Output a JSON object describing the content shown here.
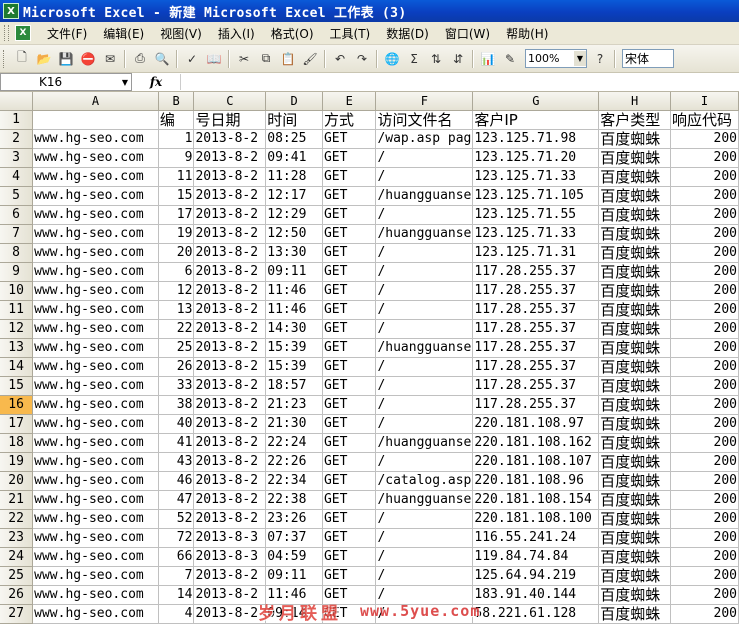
{
  "window": {
    "title": "Microsoft Excel - 新建 Microsoft Excel 工作表 (3)",
    "icon_text": "X"
  },
  "menu": {
    "items": [
      "文件(F)",
      "编辑(E)",
      "视图(V)",
      "插入(I)",
      "格式(O)",
      "工具(T)",
      "数据(D)",
      "窗口(W)",
      "帮助(H)"
    ]
  },
  "toolbar": {
    "zoom": "100%",
    "font": "宋体",
    "icons": [
      "new-icon",
      "open-icon",
      "save-icon",
      "permission-icon",
      "email-icon",
      "print-icon",
      "print-preview-icon",
      "spelling-icon",
      "research-icon",
      "cut-icon",
      "copy-icon",
      "paste-icon",
      "format-painter-icon",
      "undo-icon",
      "redo-icon",
      "hyperlink-icon",
      "autosum-icon",
      "sort-ascending-icon",
      "sort-descending-icon",
      "chart-wizard-icon",
      "drawing-icon",
      "help-icon"
    ]
  },
  "formula_bar": {
    "name_box": "K16",
    "fx": "fx",
    "formula": ""
  },
  "sheet": {
    "columns": [
      "A",
      "B",
      "C",
      "D",
      "E",
      "F",
      "G",
      "H",
      "I"
    ],
    "active_row": 16,
    "header_row": [
      "",
      "编",
      "号日期",
      "时间",
      "方式",
      "访问文件名",
      "客户IP",
      "客户类型",
      "响应代码"
    ],
    "rows": [
      [
        "www.hg-seo.com",
        "1",
        "2013-8-2",
        "08:25",
        "GET",
        "/wap.asp pag",
        "123.125.71.98",
        "百度蜘蛛",
        "200"
      ],
      [
        "www.hg-seo.com",
        "9",
        "2013-8-2",
        "09:41",
        "GET",
        "/",
        "123.125.71.20",
        "百度蜘蛛",
        "200"
      ],
      [
        "www.hg-seo.com",
        "11",
        "2013-8-2",
        "11:28",
        "GET",
        "/",
        "123.125.71.33",
        "百度蜘蛛",
        "200"
      ],
      [
        "www.hg-seo.com",
        "15",
        "2013-8-2",
        "12:17",
        "GET",
        "/huangguanse",
        "123.125.71.105",
        "百度蜘蛛",
        "200"
      ],
      [
        "www.hg-seo.com",
        "17",
        "2013-8-2",
        "12:29",
        "GET",
        "/",
        "123.125.71.55",
        "百度蜘蛛",
        "200"
      ],
      [
        "www.hg-seo.com",
        "19",
        "2013-8-2",
        "12:50",
        "GET",
        "/huangguanse",
        "123.125.71.33",
        "百度蜘蛛",
        "200"
      ],
      [
        "www.hg-seo.com",
        "20",
        "2013-8-2",
        "13:30",
        "GET",
        "/",
        "123.125.71.31",
        "百度蜘蛛",
        "200"
      ],
      [
        "www.hg-seo.com",
        "6",
        "2013-8-2",
        "09:11",
        "GET",
        "/",
        "117.28.255.37",
        "百度蜘蛛",
        "200"
      ],
      [
        "www.hg-seo.com",
        "12",
        "2013-8-2",
        "11:46",
        "GET",
        "/",
        "117.28.255.37",
        "百度蜘蛛",
        "200"
      ],
      [
        "www.hg-seo.com",
        "13",
        "2013-8-2",
        "11:46",
        "GET",
        "/",
        "117.28.255.37",
        "百度蜘蛛",
        "200"
      ],
      [
        "www.hg-seo.com",
        "22",
        "2013-8-2",
        "14:30",
        "GET",
        "/",
        "117.28.255.37",
        "百度蜘蛛",
        "200"
      ],
      [
        "www.hg-seo.com",
        "25",
        "2013-8-2",
        "15:39",
        "GET",
        "/huangguanse",
        "117.28.255.37",
        "百度蜘蛛",
        "200"
      ],
      [
        "www.hg-seo.com",
        "26",
        "2013-8-2",
        "15:39",
        "GET",
        "/",
        "117.28.255.37",
        "百度蜘蛛",
        "200"
      ],
      [
        "www.hg-seo.com",
        "33",
        "2013-8-2",
        "18:57",
        "GET",
        "/",
        "117.28.255.37",
        "百度蜘蛛",
        "200"
      ],
      [
        "www.hg-seo.com",
        "38",
        "2013-8-2",
        "21:23",
        "GET",
        "/",
        "117.28.255.37",
        "百度蜘蛛",
        "200"
      ],
      [
        "www.hg-seo.com",
        "40",
        "2013-8-2",
        "21:30",
        "GET",
        "/",
        "220.181.108.97",
        "百度蜘蛛",
        "200"
      ],
      [
        "www.hg-seo.com",
        "41",
        "2013-8-2",
        "22:24",
        "GET",
        "/huangguanse",
        "220.181.108.162",
        "百度蜘蛛",
        "200"
      ],
      [
        "www.hg-seo.com",
        "43",
        "2013-8-2",
        "22:26",
        "GET",
        "/",
        "220.181.108.107",
        "百度蜘蛛",
        "200"
      ],
      [
        "www.hg-seo.com",
        "46",
        "2013-8-2",
        "22:34",
        "GET",
        "/catalog.asp",
        "220.181.108.96",
        "百度蜘蛛",
        "200"
      ],
      [
        "www.hg-seo.com",
        "47",
        "2013-8-2",
        "22:38",
        "GET",
        "/huangguanse",
        "220.181.108.154",
        "百度蜘蛛",
        "200"
      ],
      [
        "www.hg-seo.com",
        "52",
        "2013-8-2",
        "23:26",
        "GET",
        "/",
        "220.181.108.100",
        "百度蜘蛛",
        "200"
      ],
      [
        "www.hg-seo.com",
        "72",
        "2013-8-3",
        "07:37",
        "GET",
        "/",
        "116.55.241.24",
        "百度蜘蛛",
        "200"
      ],
      [
        "www.hg-seo.com",
        "66",
        "2013-8-3",
        "04:59",
        "GET",
        "/",
        "119.84.74.84",
        "百度蜘蛛",
        "200"
      ],
      [
        "www.hg-seo.com",
        "7",
        "2013-8-2",
        "09:11",
        "GET",
        "/",
        "125.64.94.219",
        "百度蜘蛛",
        "200"
      ],
      [
        "www.hg-seo.com",
        "14",
        "2013-8-2",
        "11:46",
        "GET",
        "/",
        "183.91.40.144",
        "百度蜘蛛",
        "200"
      ],
      [
        "www.hg-seo.com",
        "4",
        "2013-8-2",
        "09:14",
        "GET",
        "/",
        "58.221.61.128",
        "百度蜘蛛",
        "200"
      ]
    ]
  },
  "watermark": {
    "text": "岁月联盟",
    "site": "www.5yue.com"
  },
  "colors": {
    "titlebar": "#0a3fc0",
    "active_row_header": "#f8b94d",
    "watermark": "#e0413a"
  }
}
